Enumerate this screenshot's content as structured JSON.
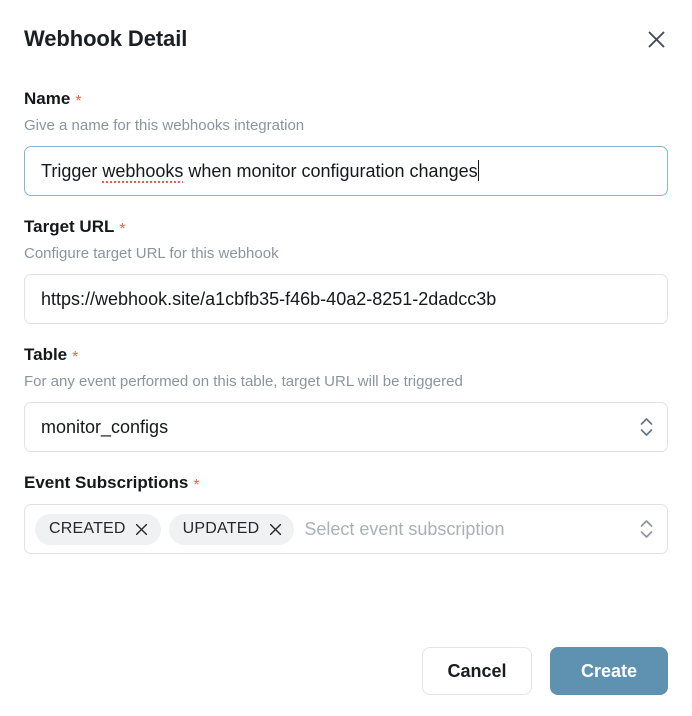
{
  "dialog": {
    "title": "Webhook Detail",
    "close_icon": "close-icon"
  },
  "fields": {
    "name": {
      "label": "Name",
      "required_marker": "*",
      "help": "Give a name for this webhooks integration",
      "value_prefix": "Trigger ",
      "value_misspelled": "webhooks",
      "value_suffix": " when monitor configuration changes",
      "value": "Trigger webhooks when monitor configuration changes",
      "focused": true,
      "has_caret": true
    },
    "target_url": {
      "label": "Target URL",
      "required_marker": "*",
      "help": "Configure target URL for this webhook",
      "value": "https://webhook.site/a1cbfb35-f46b-40a2-8251-2dadcc3b"
    },
    "table": {
      "label": "Table",
      "required_marker": "*",
      "help": "For any event performed on this table, target URL will be triggered",
      "value": "monitor_configs",
      "chevron_icon": "chevron-up-down-icon"
    },
    "event_subscriptions": {
      "label": "Event Subscriptions",
      "required_marker": "*",
      "placeholder": "Select event subscription",
      "chevron_icon": "chevron-up-down-icon",
      "tags": [
        {
          "label": "CREATED",
          "remove_icon": "close-icon"
        },
        {
          "label": "UPDATED",
          "remove_icon": "close-icon"
        }
      ]
    }
  },
  "footer": {
    "cancel_label": "Cancel",
    "create_label": "Create"
  },
  "colors": {
    "primary_button": "#5f92b0",
    "required_star": "#f4604f",
    "focus_border": "#85b6d4",
    "border": "#dfe3e8",
    "help_text": "#8b949e",
    "spellcheck_underline": "#f0584a",
    "tag_background": "#f0f1f3"
  }
}
